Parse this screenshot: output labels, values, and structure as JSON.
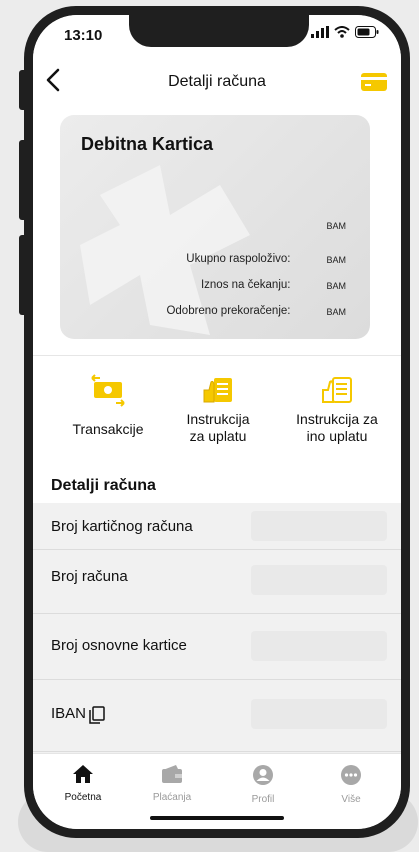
{
  "status_bar": {
    "time": "13:10"
  },
  "header": {
    "title": "Detalji računa"
  },
  "card": {
    "title": "Debitna Kartica",
    "top_currency": "BAM",
    "rows": [
      {
        "label": "Ukupno raspoloživo:",
        "currency": "BAM"
      },
      {
        "label": "Iznos na čekanju:",
        "currency": "BAM"
      },
      {
        "label": "Odobreno prekoračenje:",
        "currency": "BAM"
      }
    ]
  },
  "actions": [
    {
      "line1": "Transakcije",
      "line2": "",
      "icon": "money-transfer-icon"
    },
    {
      "line1": "Instrukcija",
      "line2": "za uplatu",
      "icon": "instruction-icon"
    },
    {
      "line1": "Instrukcija za",
      "line2": "ino uplatu",
      "icon": "instruction-icon"
    }
  ],
  "details": {
    "section_title": "Detalji računa",
    "rows": [
      {
        "label": "Broj kartičnog računa"
      },
      {
        "label": "Broj računa"
      },
      {
        "label": "Broj osnovne kartice"
      },
      {
        "label": "IBAN"
      }
    ]
  },
  "tabbar": {
    "items": [
      {
        "label": "Početna",
        "icon": "home-icon",
        "active": true
      },
      {
        "label": "Plaćanja",
        "icon": "wallet-icon",
        "active": false
      },
      {
        "label": "Profil",
        "icon": "profile-icon",
        "active": false
      },
      {
        "label": "Više",
        "icon": "more-icon",
        "active": false
      }
    ]
  },
  "colors": {
    "accent": "#f5c800",
    "text": "#111111",
    "inactive": "#9a9a9a",
    "frame": "#1f1f1f"
  }
}
